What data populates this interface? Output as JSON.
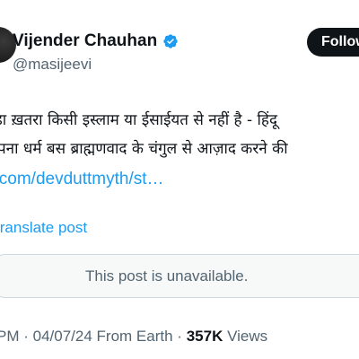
{
  "author": {
    "name": "Vijender Chauhan",
    "handle": "@masijeevi",
    "verified_color": "#1d9bf0"
  },
  "follow_button": {
    "label": "Follow"
  },
  "tweet": {
    "line1": "बड़ा ख़तरा किसी इस्लाम या ईसाईयत से नहीं है - हिंदू",
    "line2": "अपना धर्म बस ब्राह्मणवाद के चंगुल से आज़ाद करने की",
    "link": "x.com/devduttmyth/st…"
  },
  "translate": {
    "label": "Translate post"
  },
  "quoted": {
    "message": "This post is unavailable."
  },
  "meta": {
    "time": "PM",
    "separator": "·",
    "date": "04/07/24 From Earth",
    "views_count": "357K",
    "views_label": "Views"
  },
  "colors": {
    "link": "#1d9bf0",
    "text": "#0f1419",
    "muted": "#536471"
  }
}
